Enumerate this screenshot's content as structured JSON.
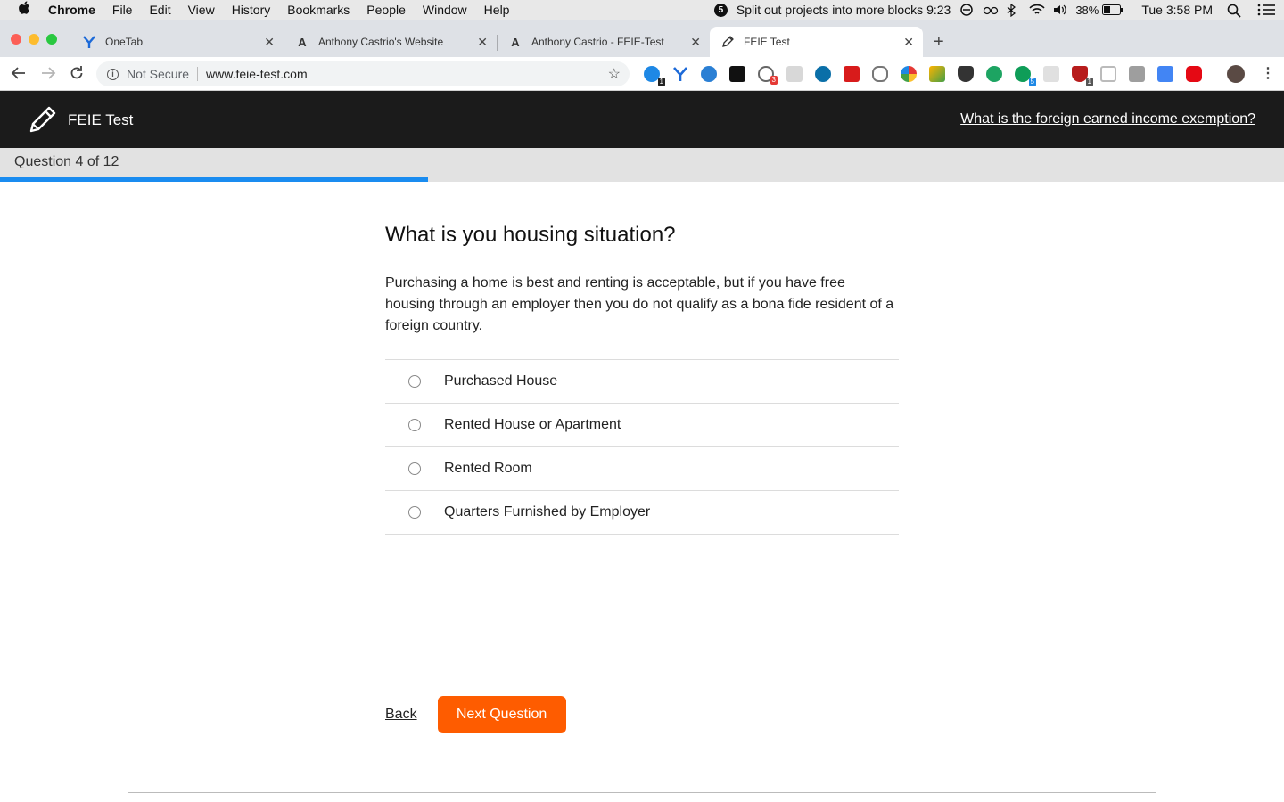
{
  "menubar": {
    "app": "Chrome",
    "items": [
      "File",
      "Edit",
      "View",
      "History",
      "Bookmarks",
      "People",
      "Window",
      "Help"
    ],
    "focus_badge": "5",
    "focus_text": "Split out projects into more blocks 9:23",
    "battery": "38%",
    "clock": "Tue 3:58 PM"
  },
  "tabs": [
    {
      "title": "OneTab",
      "icon": "onetab-icon"
    },
    {
      "title": "Anthony Castrio's Website",
      "icon": "letter-a-icon"
    },
    {
      "title": "Anthony Castrio - FEIE-Test",
      "icon": "letter-a-icon"
    },
    {
      "title": "FEIE Test",
      "icon": "pencil-icon",
      "active": true
    }
  ],
  "address": {
    "security": "Not Secure",
    "url": "www.feie-test.com"
  },
  "extension_badges": {
    "ext1": "1",
    "ext5": "3",
    "ext13": "5",
    "ext15": "1"
  },
  "header": {
    "brand": "FEIE Test",
    "help_link": "What is the foreign earned income exemption?"
  },
  "progress": {
    "label": "Question 4 of 12",
    "fraction": 0.3333
  },
  "question": {
    "title": "What is you housing situation?",
    "description": "Purchasing a home is best and renting is acceptable, but if you have free housing through an employer then you do not qualify as a bona fide resident of a foreign country.",
    "options": [
      "Purchased House",
      "Rented House or Apartment",
      "Rented Room",
      "Quarters Furnished by Employer"
    ]
  },
  "actions": {
    "back": "Back",
    "next": "Next Question"
  },
  "colors": {
    "accent": "#fe5c00",
    "progress": "#1a8cf0",
    "header_bg": "#1b1b1b"
  }
}
